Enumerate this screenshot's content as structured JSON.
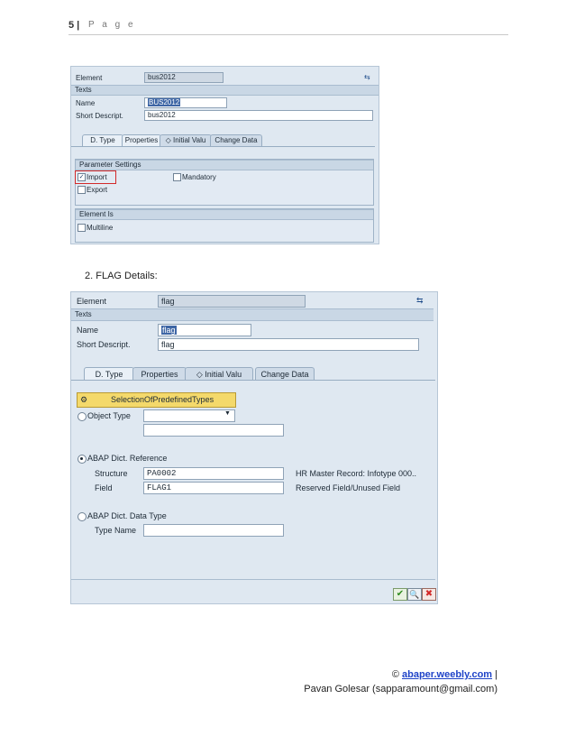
{
  "header": {
    "page_number": "5 |",
    "page_word": "P a g e"
  },
  "screen1": {
    "element_label": "Element",
    "element_value": "bus2012",
    "texts_label": "Texts",
    "name_label": "Name",
    "name_value": "BUS2012",
    "short_label": "Short Descript.",
    "short_value": "bus2012",
    "tabs": [
      "D. Type",
      "Properties",
      "◇ Initial Valu",
      "Change Data"
    ],
    "param_section": "Parameter Settings",
    "import_label": "Import",
    "export_label": "Export",
    "mandatory_label": "Mandatory",
    "element_is_section": "Element Is",
    "multiline_label": "Multiline"
  },
  "list_item": "2.   FLAG Details:",
  "screen2": {
    "element_label": "Element",
    "element_value": "flag",
    "texts_label": "Texts",
    "name_label": "Name",
    "name_value": "flag",
    "short_label": "Short Descript.",
    "short_value": "flag",
    "tabs": [
      "D. Type",
      "Properties",
      "◇ Initial Valu",
      "Change Data"
    ],
    "predefined_button": "SelectionOfPredefinedTypes",
    "object_type_label": "Object Type",
    "abap_ref_label": "ABAP Dict. Reference",
    "structure_label": "Structure",
    "structure_value": "PA0002",
    "structure_desc": "HR Master Record: Infotype 000..",
    "field_label": "Field",
    "field_value": "FLAG1",
    "field_desc": "Reserved Field/Unused Field",
    "abap_data_type_label": "ABAP Dict. Data Type",
    "type_name_label": "Type Name",
    "buttons": [
      "confirm",
      "check",
      "cancel"
    ]
  },
  "footer": {
    "copyright": "© ",
    "link": "abaper.weebly.com",
    "sep": " |",
    "author": "Pavan Golesar (sapparamount@gmail.com)"
  },
  "colors": {
    "accent_red": "#d32a2a",
    "link_blue": "#1f43c8",
    "sap_bg": "#dfe8f1"
  }
}
